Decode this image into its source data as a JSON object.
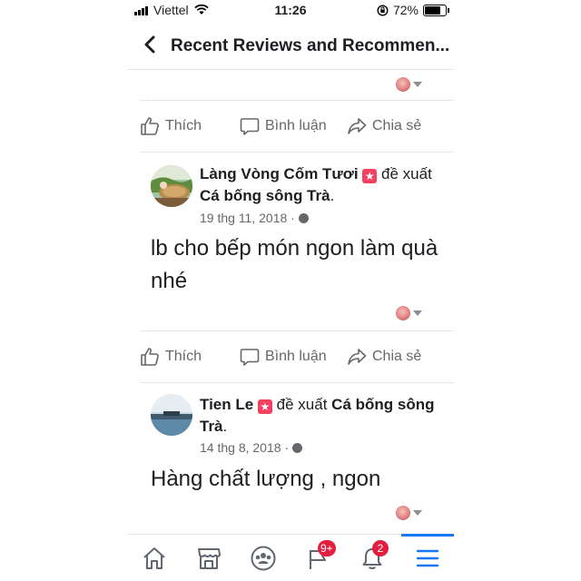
{
  "status": {
    "carrier": "Viettel",
    "time": "11:26",
    "battery": "72%"
  },
  "header": {
    "title": "Recent Reviews and Recommen..."
  },
  "actions": {
    "like": "Thích",
    "comment": "Bình luận",
    "share": "Chia sẻ"
  },
  "posts": [
    {
      "name": "Làng Vòng Cốm Tươi",
      "badge": "★",
      "verb": "đề xuất",
      "target": "Cá bống sông Trà",
      "dot": ".",
      "date": "19 thg 11, 2018 ·",
      "text": "lb cho bếp món ngon làm quà nhé"
    },
    {
      "name": "Tien Le",
      "badge": "★",
      "verb": "đề xuất",
      "target": "Cá bống sông Trà",
      "dot": ".",
      "date": "14 thg 8, 2018 ·",
      "text": "Hàng chất lượng , ngon"
    }
  ],
  "tabbar": {
    "groups_badge": "9+",
    "notifications_badge": "2"
  },
  "colors": {
    "accent": "#1877f2",
    "badge": "#e41e3f",
    "muted": "#65676b"
  }
}
